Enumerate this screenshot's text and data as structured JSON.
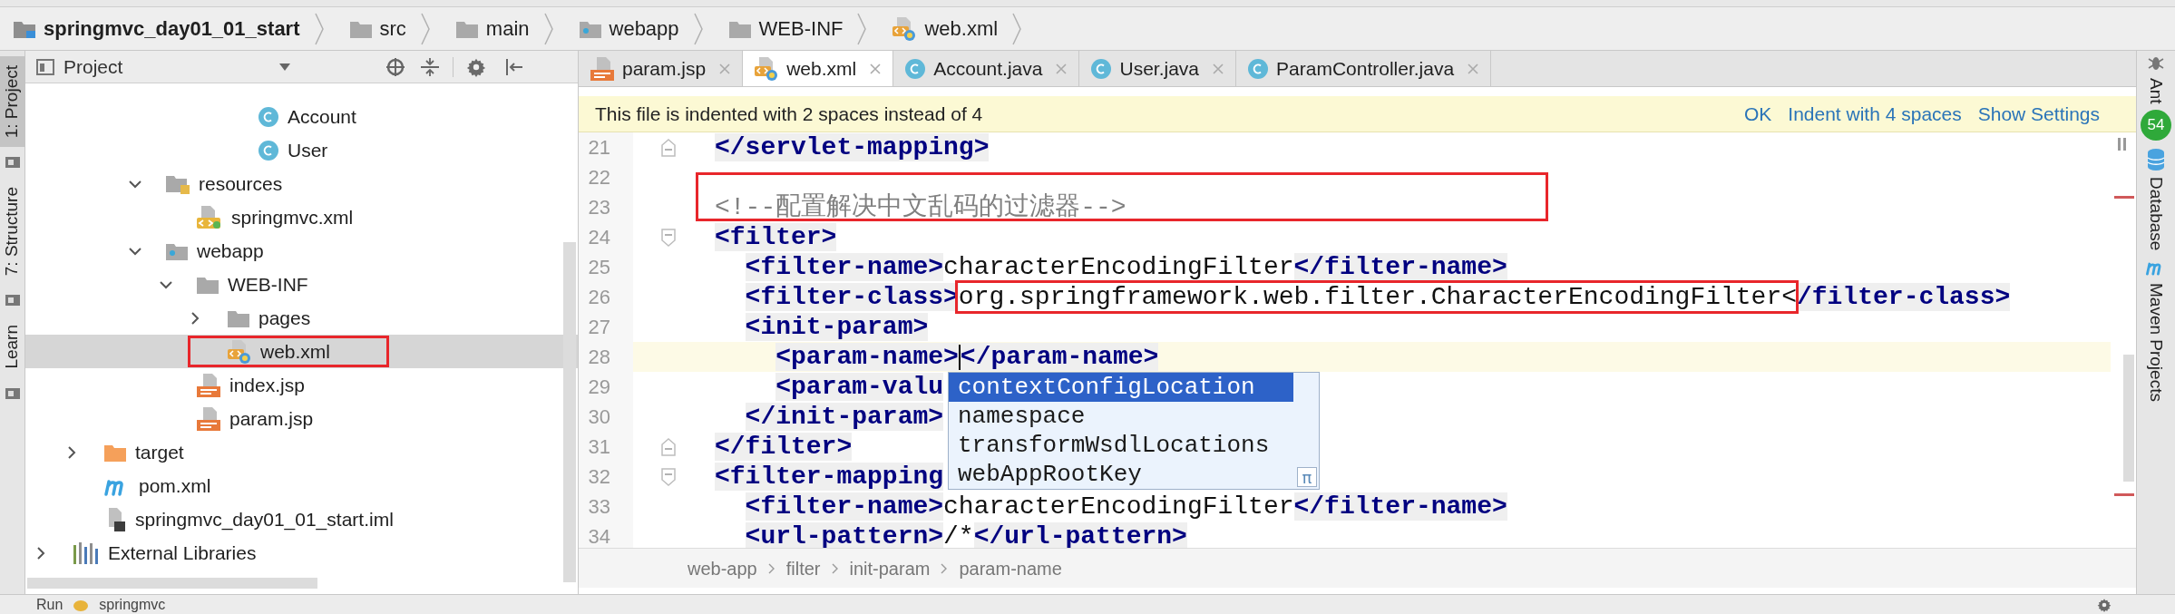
{
  "navbar": {
    "crumbs": [
      {
        "label": "springmvc_day01_01_start",
        "kind": "project"
      },
      {
        "label": "src",
        "kind": "folder"
      },
      {
        "label": "main",
        "kind": "folder"
      },
      {
        "label": "webapp",
        "kind": "webfolder"
      },
      {
        "label": "WEB-INF",
        "kind": "folder"
      },
      {
        "label": "web.xml",
        "kind": "webxml"
      }
    ]
  },
  "left_stripe": [
    {
      "label": "1: Project",
      "selected": true
    },
    {
      "label": "7: Structure",
      "selected": false
    },
    {
      "label": "Learn",
      "selected": false
    }
  ],
  "project_panel": {
    "title": "Project",
    "tree": [
      {
        "children": [
          {
            "children": [
              {
                "children": [
                  {
                    "children": [
                      {
                        "children": [
                          {
                            "children": [
                              {
                                "label": "Account",
                                "kind": "class",
                                "selected": false,
                                "annotated": false
                              },
                              {
                                "label": "User",
                                "kind": "class",
                                "selected": false,
                                "annotated": false
                              }
                            ]
                          }
                        ]
                      }
                    ]
                  },
                  {
                    "label": "resources",
                    "kind": "resources",
                    "expanded": true,
                    "selected": false,
                    "annotated": false,
                    "children": [
                      {
                        "label": "springmvc.xml",
                        "kind": "xml",
                        "selected": false,
                        "annotated": false
                      }
                    ]
                  },
                  {
                    "label": "webapp",
                    "kind": "webfolder",
                    "expanded": true,
                    "selected": false,
                    "annotated": false,
                    "children": [
                      {
                        "label": "WEB-INF",
                        "kind": "folder",
                        "expanded": true,
                        "selected": false,
                        "annotated": false,
                        "children": [
                          {
                            "label": "pages",
                            "kind": "folder",
                            "expanded": false,
                            "selected": false,
                            "annotated": false
                          },
                          {
                            "label": "web.xml",
                            "kind": "webxml",
                            "selected": true,
                            "annotated": true
                          }
                        ]
                      },
                      {
                        "label": "index.jsp",
                        "kind": "jsp",
                        "selected": false,
                        "annotated": false
                      },
                      {
                        "label": "param.jsp",
                        "kind": "jsp",
                        "selected": false,
                        "annotated": false
                      }
                    ]
                  }
                ]
              }
            ]
          },
          {
            "label": "target",
            "kind": "target",
            "expanded": false,
            "selected": false,
            "annotated": false
          },
          {
            "label": "pom.xml",
            "kind": "maven",
            "selected": false,
            "annotated": false
          },
          {
            "label": "springmvc_day01_01_start.iml",
            "kind": "iml",
            "selected": false,
            "annotated": false
          }
        ]
      },
      {
        "label": "External Libraries",
        "kind": "libraries",
        "expanded": false,
        "selected": false,
        "annotated": false
      }
    ]
  },
  "tabs": [
    {
      "label": "param.jsp",
      "kind": "jsp",
      "selected": false
    },
    {
      "label": "web.xml",
      "kind": "webxml",
      "selected": true
    },
    {
      "label": "Account.java",
      "kind": "class",
      "selected": false
    },
    {
      "label": "User.java",
      "kind": "class",
      "selected": false
    },
    {
      "label": "ParamController.java",
      "kind": "class",
      "selected": false
    }
  ],
  "banner": {
    "message": "This file is indented with 2 spaces instead of 4",
    "actions": [
      "OK",
      "Indent with 4 spaces",
      "Show Settings"
    ]
  },
  "editor": {
    "lines": [
      {
        "number": "21",
        "fold_end": true,
        "segments": [
          {
            "kind": "tag",
            "text": "</servlet-mapping>"
          }
        ]
      },
      {
        "number": "22"
      },
      {
        "number": "23",
        "annotated": true,
        "segments": [
          {
            "kind": "comment",
            "text": "<!--配置解决中文乱码的过滤器-->"
          }
        ]
      },
      {
        "number": "24",
        "fold_start": true,
        "segments": [
          {
            "kind": "tag",
            "text": "<filter>"
          }
        ]
      },
      {
        "number": "25",
        "segments": [
          {
            "kind": "tag",
            "text": "  <filter-name>"
          },
          {
            "kind": "text",
            "text": "characterEncodingFilter"
          },
          {
            "kind": "tag",
            "text": "</filter-name>"
          }
        ]
      },
      {
        "number": "26",
        "segments": [
          {
            "kind": "tag",
            "text": "  <filter-class>"
          },
          {
            "kind": "text",
            "text": "org.springframework.web.filter.CharacterEncodingFilter<",
            "annotated": true
          },
          {
            "kind": "tag",
            "text": "/filter-class>"
          }
        ]
      },
      {
        "number": "27",
        "segments": [
          {
            "kind": "tag",
            "text": "  <init-param>"
          }
        ]
      },
      {
        "number": "28",
        "current": true,
        "segments": [
          {
            "kind": "tag",
            "text": "    <param-name>"
          },
          {
            "kind": "caret"
          },
          {
            "kind": "tag",
            "text": "</param-name>"
          }
        ]
      },
      {
        "number": "29",
        "segments": [
          {
            "kind": "tag",
            "text": "    <param-valu"
          }
        ]
      },
      {
        "number": "30",
        "segments": [
          {
            "kind": "tag",
            "text": "  </init-param>"
          }
        ]
      },
      {
        "number": "31",
        "fold_end": true,
        "segments": [
          {
            "kind": "tag",
            "text": "</filter>"
          }
        ]
      },
      {
        "number": "32",
        "fold_start": true,
        "segments": [
          {
            "kind": "tag",
            "text": "<filter-mapping"
          }
        ]
      },
      {
        "number": "33",
        "segments": [
          {
            "kind": "tag",
            "text": "  <filter-name>"
          },
          {
            "kind": "text",
            "text": "characterEncodingFilter"
          },
          {
            "kind": "tag",
            "text": "</filter-name>"
          }
        ]
      },
      {
        "number": "34",
        "segments": [
          {
            "kind": "tag",
            "text": "  <url-pattern>"
          },
          {
            "kind": "text",
            "text": "/*"
          },
          {
            "kind": "tag",
            "text": "</url-pattern>"
          }
        ]
      }
    ],
    "completion": {
      "items": [
        {
          "label": "contextConfigLocation",
          "selected": true
        },
        {
          "label": "namespace",
          "selected": false
        },
        {
          "label": "transformWsdlLocations",
          "selected": false
        },
        {
          "label": "webAppRootKey",
          "selected": false
        }
      ],
      "hint": "π"
    },
    "breadcrumbs": [
      "web-app",
      "filter",
      "init-param",
      "param-name"
    ]
  },
  "right_stripe": [
    {
      "label": "Ant",
      "kind": "ant",
      "badge": "54"
    },
    {
      "label": "Database",
      "kind": "database"
    },
    {
      "label": "Maven Projects",
      "kind": "maven"
    }
  ],
  "bottom": {
    "tool": "Run",
    "config": "springmvc"
  }
}
